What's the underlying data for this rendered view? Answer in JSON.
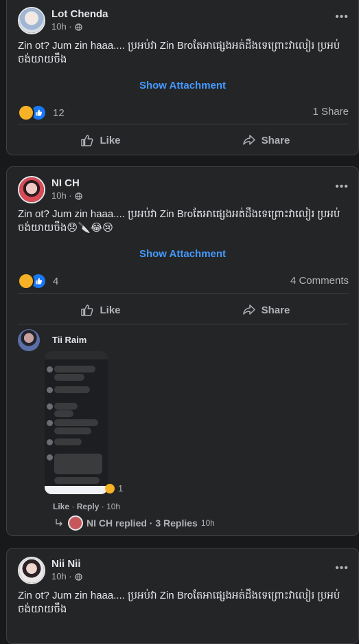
{
  "posts": [
    {
      "author": "Lot Chenda",
      "time": "10h ·",
      "text": "Zin ot? Jum zin haaa.... ប្រអប់វា Zin Broតែអាផ្សេងអត់ដឹងទេព្រោះវាលៀរ ប្រអប់ ចង់យាយចឹង",
      "attachment_label": "Show Attachment",
      "reaction_count": "12",
      "right_stat": "1 Share",
      "like_label": "Like",
      "share_label": "Share",
      "reactions": [
        "haha",
        "like"
      ]
    },
    {
      "author": "NI CH",
      "time": "10h ·",
      "text": "Zin ot? Jum zin haaa.... ប្រអប់វា Zin Broតែអាផ្សេងអត់ដឹងទេព្រោះវាលៀរ ប្រអប់ ចង់យាយចឹង😞🔪😂😢",
      "attachment_label": "Show Attachment",
      "reaction_count": "4",
      "right_stat": "4 Comments",
      "like_label": "Like",
      "share_label": "Share",
      "reactions": [
        "haha",
        "like"
      ],
      "comment": {
        "author": "Tii Raim",
        "reaction_count": "1",
        "like_label": "Like",
        "reply_label": "Reply",
        "time": "10h",
        "separator": "·",
        "replies_text": "NI CH replied · 3 Replies",
        "replies_time": "10h"
      }
    },
    {
      "author": "Nii Nii",
      "time": "10h ·",
      "text": "Zin ot? Jum zin haaa.... ប្រអប់វា Zin Broតែអាផ្សេងអត់ដឹងទេព្រោះវាលៀរ ប្រអប់ ចង់យាយចឹង"
    }
  ],
  "colors": {
    "background": "#18191a",
    "card": "#242526",
    "link": "#4599ff",
    "haha": "#f7b125",
    "like": "#1877f2"
  },
  "icons": [
    "more-icon",
    "globe-icon",
    "haha-reaction-icon",
    "like-reaction-icon",
    "thumbs-up-icon",
    "share-arrow-icon",
    "reply-arrow-icon"
  ]
}
